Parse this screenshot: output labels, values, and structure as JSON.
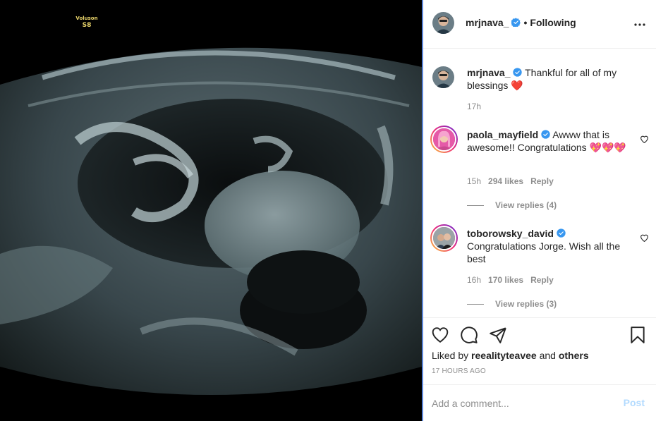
{
  "media": {
    "machine_label_line1": "Voluson",
    "machine_label_line2": "S8"
  },
  "header": {
    "username": "mrjnava_",
    "separator": "•",
    "follow_status": "Following"
  },
  "caption": {
    "username": "mrjnava_",
    "text": "Thankful for all of my blessings",
    "emoji": "❤️",
    "time": "17h"
  },
  "comments": [
    {
      "username": "paola_mayfield",
      "text": "Awww that is awesome!! Congratulations",
      "emoji": "💖💖💖",
      "time": "15h",
      "likes": "294 likes",
      "reply_label": "Reply",
      "view_replies": "View replies (4)"
    },
    {
      "username": "toborowsky_david",
      "text": "Congratulations Jorge. Wish all the best",
      "time": "16h",
      "likes": "170 likes",
      "reply_label": "Reply",
      "view_replies": "View replies (3)"
    }
  ],
  "liked_by": {
    "prefix": "Liked by",
    "user": "reealityteavee",
    "joiner": "and",
    "others": "others"
  },
  "post_time": "17 HOURS AGO",
  "add_comment": {
    "placeholder": "Add a comment...",
    "post_label": "Post"
  },
  "colors": {
    "verified": "#3897f0",
    "divider": "#5b84d6",
    "post_disabled": "#b3dbff"
  }
}
